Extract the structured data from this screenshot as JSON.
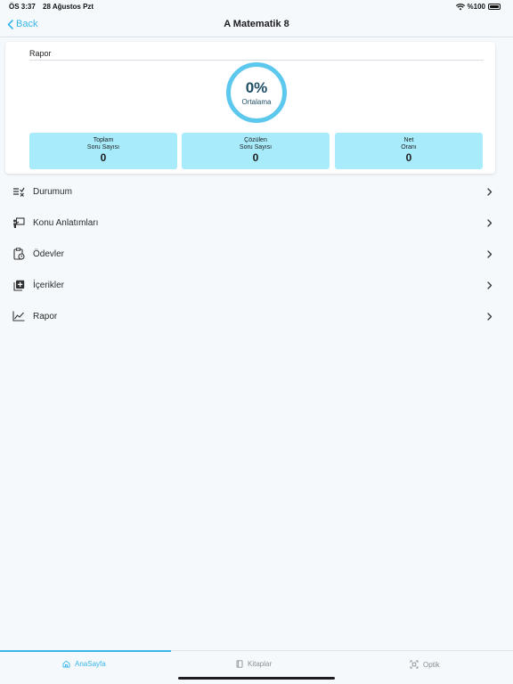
{
  "status_bar": {
    "time": "ÖS 3:37",
    "date": "28 Ağustos Pzt",
    "battery": "%100"
  },
  "nav": {
    "back_label": "Back",
    "title": "A Matematik 8"
  },
  "report_card": {
    "title": "Rapor",
    "gauge": {
      "percent": "0%",
      "label": "Ortalama"
    },
    "stats": [
      {
        "line1": "Toplam",
        "line2": "Soru Sayısı",
        "value": "0"
      },
      {
        "line1": "Çözülen",
        "line2": "Soru Sayısı",
        "value": "0"
      },
      {
        "line1": "Net",
        "line2": "Oranı",
        "value": "0"
      }
    ]
  },
  "menu": [
    {
      "label": "Durumum",
      "icon": "status-list-icon"
    },
    {
      "label": "Konu Anlatımları",
      "icon": "presentation-icon"
    },
    {
      "label": "Ödevler",
      "icon": "homework-clipboard-icon"
    },
    {
      "label": "İçerikler",
      "icon": "content-add-icon"
    },
    {
      "label": "Rapor",
      "icon": "line-chart-icon"
    }
  ],
  "tabs": [
    {
      "label": "AnaSayfa",
      "icon": "home-icon",
      "active": true
    },
    {
      "label": "Kitaplar",
      "icon": "book-icon",
      "active": false
    },
    {
      "label": "Optik",
      "icon": "scan-icon",
      "active": false
    }
  ],
  "colors": {
    "accent": "#38b6e8",
    "stat_box": "#a8ecfb",
    "gauge_ring": "#5cc8ee",
    "gauge_text": "#1e4f66"
  }
}
